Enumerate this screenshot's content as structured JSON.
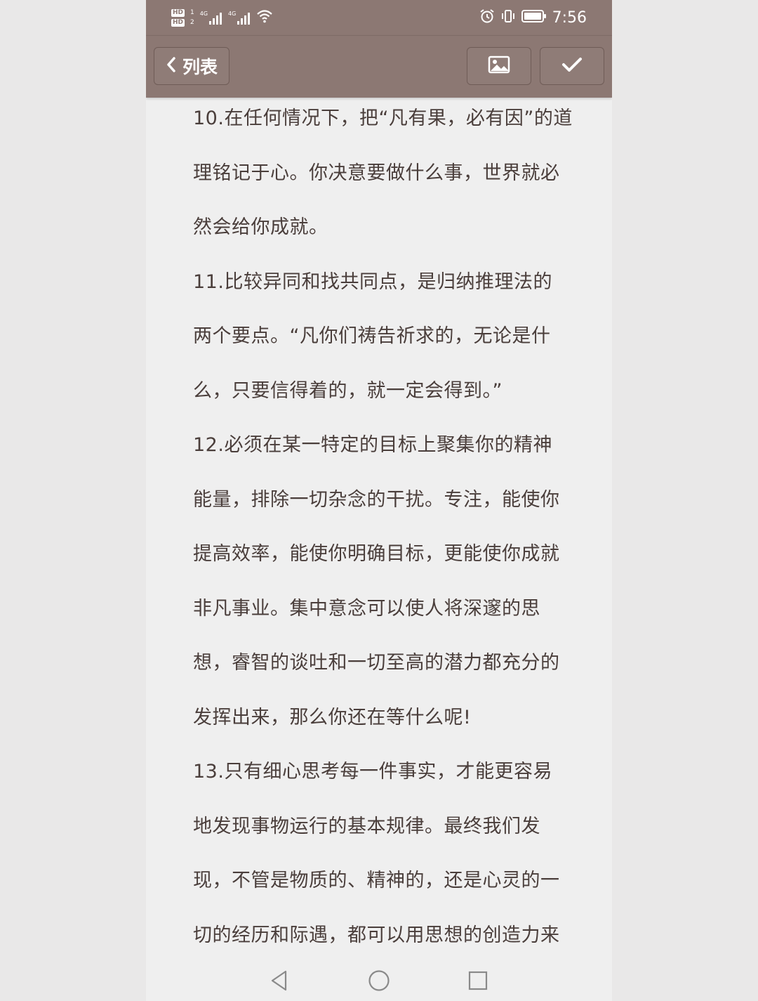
{
  "status_bar": {
    "hd_badges": [
      "HD",
      "HD"
    ],
    "sim_slots": [
      "1",
      "2"
    ],
    "network_1": "4G",
    "network_2": "4G",
    "time": "7:56",
    "icons": [
      "signal-icon",
      "wifi-icon",
      "alarm-icon",
      "vibrate-icon",
      "battery-icon"
    ]
  },
  "toolbar": {
    "back_label": "列表",
    "back_icon": "chevron-left-icon",
    "image_icon": "image-icon",
    "confirm_icon": "checkmark-icon"
  },
  "content": {
    "lines": [
      "10.在任何情况下，把“凡有果，必有因”的道",
      "理铭记于心。你决意要做什么事，世界就必",
      "然会给你成就。",
      "11.比较异同和找共同点，是归纳推理法的",
      "两个要点。“凡你们祷告祈求的，无论是什",
      "么，只要信得着的，就一定会得到。”",
      "12.必须在某一特定的目标上聚集你的精神",
      "能量，排除一切杂念的干扰。专注，能使你",
      "提高效率，能使你明确目标，更能使你成就",
      "非凡事业。集中意念可以使人将深邃的思",
      "想，睿智的谈吐和一切至高的潜力都充分的",
      "发挥出来，那么你还在等什么呢!",
      "13.只有细心思考每一件事实，才能更容易",
      "地发现事物运行的基本规律。最终我们发",
      "现，不管是物质的、精神的，还是心灵的一",
      "切的经历和际遇，都可以用思想的创造力来"
    ]
  },
  "nav_bar": {
    "icons": [
      "back-triangle-icon",
      "home-circle-icon",
      "recents-square-icon"
    ]
  },
  "colors": {
    "toolbar_bg": "#8c7873",
    "text": "#4a3e3b",
    "page_bg": "#efefef"
  }
}
